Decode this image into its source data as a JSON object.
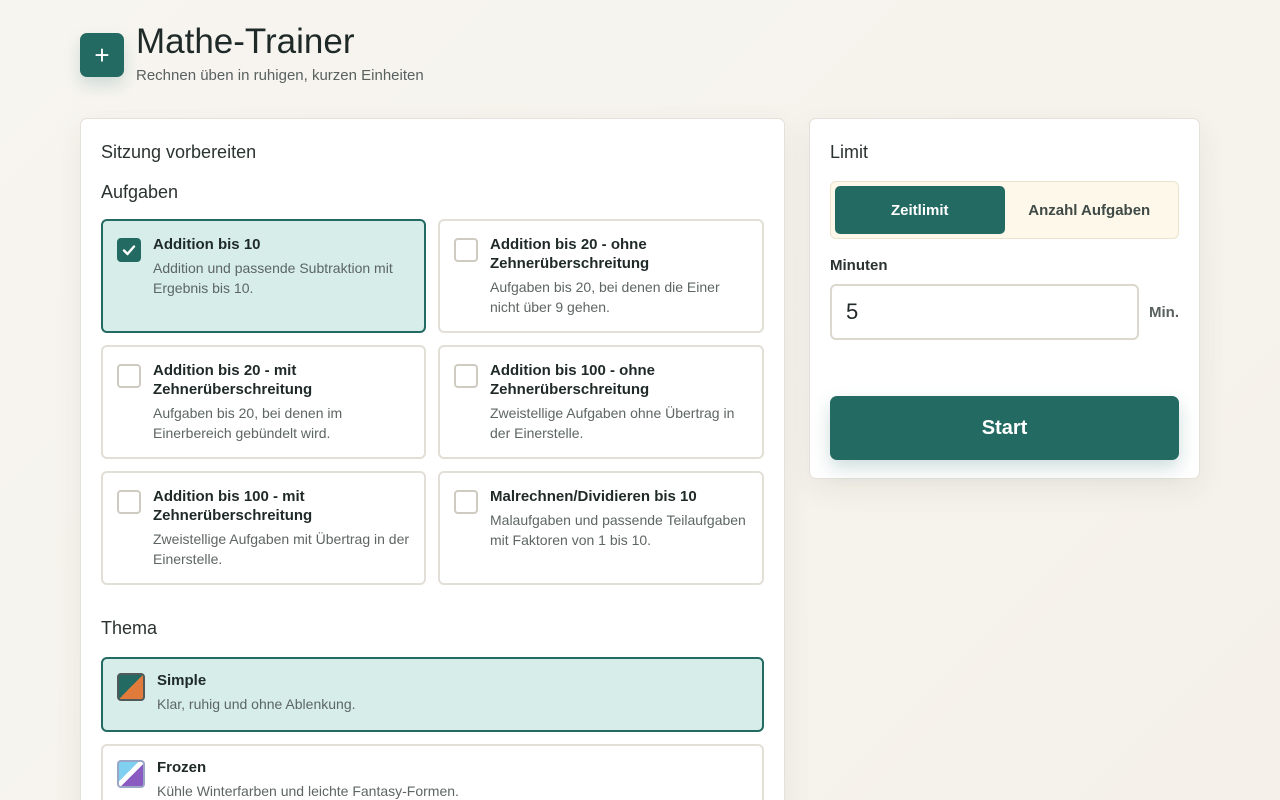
{
  "app": {
    "logo_symbol": "+",
    "title": "Mathe-Trainer",
    "subtitle": "Rechnen üben in ruhigen, kurzen Einheiten"
  },
  "session": {
    "title": "Sitzung vorbereiten",
    "tasks_label": "Aufgaben",
    "tasks": [
      {
        "title": "Addition bis 10",
        "desc": "Addition und passende Subtraktion mit Ergebnis bis 10.",
        "selected": true
      },
      {
        "title": "Addition bis 20 - ohne Zehnerüberschreitung",
        "desc": "Aufgaben bis 20, bei denen die Einer nicht über 9 gehen.",
        "selected": false
      },
      {
        "title": "Addition bis 20 - mit Zehnerüberschreitung",
        "desc": "Aufgaben bis 20, bei denen im Einerbereich gebündelt wird.",
        "selected": false
      },
      {
        "title": "Addition bis 100 - ohne Zehnerüberschreitung",
        "desc": "Zweistellige Aufgaben ohne Übertrag in der Einerstelle.",
        "selected": false
      },
      {
        "title": "Addition bis 100 - mit Zehnerüberschreitung",
        "desc": "Zweistellige Aufgaben mit Übertrag in der Einerstelle.",
        "selected": false
      },
      {
        "title": "Malrechnen/Dividieren bis 10",
        "desc": "Malaufgaben und passende Teilaufgaben mit Faktoren von 1 bis 10.",
        "selected": false
      }
    ],
    "theme_label": "Thema",
    "themes": [
      {
        "title": "Simple",
        "desc": "Klar, ruhig und ohne Ablenkung.",
        "selected": true
      },
      {
        "title": "Frozen",
        "desc": "Kühle Winterfarben und leichte Fantasy-Formen.",
        "selected": false
      }
    ]
  },
  "limit": {
    "title": "Limit",
    "mode_time": "Zeitlimit",
    "mode_count": "Anzahl Aufgaben",
    "active_mode": "time",
    "minutes_label": "Minuten",
    "minutes_value": "5",
    "unit": "Min.",
    "start_label": "Start"
  },
  "colors": {
    "accent": "#236b62",
    "selected_bg": "#d6ede9",
    "swatch_orange": "#e07b3b"
  }
}
